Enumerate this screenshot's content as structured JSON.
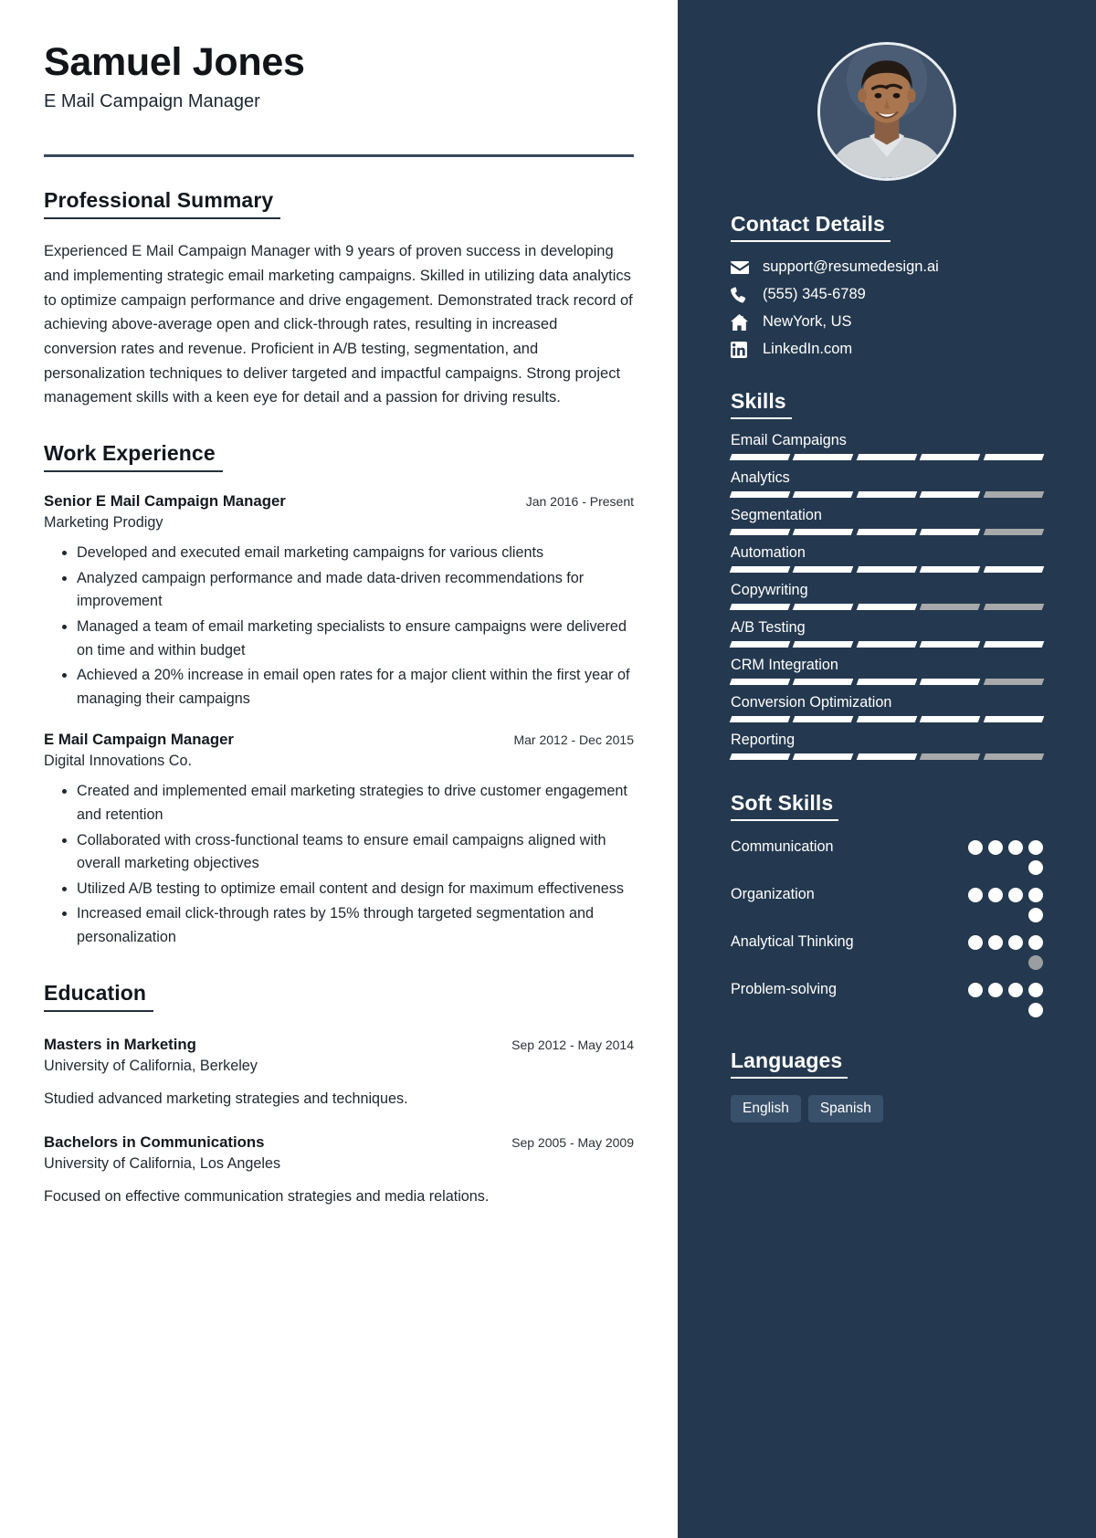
{
  "header": {
    "name": "Samuel Jones",
    "job_title": "E Mail Campaign Manager"
  },
  "theme": {
    "sidebar_bg": "#24394f",
    "rule_color": "#36495c",
    "segment_on": "#ffffff",
    "segment_off": "#a7a9ab",
    "pill_bg": "#39506a"
  },
  "professional_summary": {
    "title": "Professional Summary",
    "text": "Experienced E Mail Campaign Manager with 9 years of proven success in developing and implementing strategic email marketing campaigns. Skilled in utilizing data analytics to optimize campaign performance and drive engagement. Demonstrated track record of achieving above-average open and click-through rates, resulting in increased conversion rates and revenue. Proficient in A/B testing, segmentation, and personalization techniques to deliver targeted and impactful campaigns. Strong project management skills with a keen eye for detail and a passion for driving results."
  },
  "work_experience": {
    "title": "Work Experience",
    "entries": [
      {
        "role": "Senior E Mail Campaign Manager",
        "date": "Jan 2016 - Present",
        "organization": "Marketing Prodigy",
        "bullets": [
          "Developed and executed email marketing campaigns for various clients",
          "Analyzed campaign performance and made data-driven recommendations for improvement",
          "Managed a team of email marketing specialists to ensure campaigns were delivered on time and within budget",
          "Achieved a 20% increase in email open rates for a major client within the first year of managing their campaigns"
        ]
      },
      {
        "role": "E Mail Campaign Manager",
        "date": "Mar 2012 - Dec 2015",
        "organization": "Digital Innovations Co.",
        "bullets": [
          "Created and implemented email marketing strategies to drive customer engagement and retention",
          "Collaborated with cross-functional teams to ensure email campaigns aligned with overall marketing objectives",
          "Utilized A/B testing to optimize email content and design for maximum effectiveness",
          "Increased email click-through rates by 15% through targeted segmentation and personalization"
        ]
      }
    ]
  },
  "education": {
    "title": "Education",
    "entries": [
      {
        "degree": "Masters in Marketing",
        "date": "Sep 2012 - May 2014",
        "institution": "University of California, Berkeley",
        "description": "Studied advanced marketing strategies and techniques."
      },
      {
        "degree": "Bachelors in Communications",
        "date": "Sep 2005 - May 2009",
        "institution": "University of California, Los Angeles",
        "description": "Focused on effective communication strategies and media relations."
      }
    ]
  },
  "contact": {
    "title": "Contact Details",
    "items": [
      {
        "icon": "envelope-icon",
        "value": "support@resumedesign.ai"
      },
      {
        "icon": "phone-icon",
        "value": "(555) 345-6789"
      },
      {
        "icon": "home-icon",
        "value": "NewYork, US"
      },
      {
        "icon": "linkedin-icon",
        "value": "LinkedIn.com"
      }
    ]
  },
  "skills": {
    "title": "Skills",
    "max_level": 5,
    "items": [
      {
        "name": "Email Campaigns",
        "level": 5
      },
      {
        "name": "Analytics",
        "level": 4
      },
      {
        "name": "Segmentation",
        "level": 4
      },
      {
        "name": "Automation",
        "level": 5
      },
      {
        "name": "Copywriting",
        "level": 3
      },
      {
        "name": "A/B Testing",
        "level": 5
      },
      {
        "name": "CRM Integration",
        "level": 4
      },
      {
        "name": "Conversion Optimization",
        "level": 5
      },
      {
        "name": "Reporting",
        "level": 3
      }
    ]
  },
  "soft_skills": {
    "title": "Soft Skills",
    "max_level": 5,
    "items": [
      {
        "name": "Communication",
        "level": 5
      },
      {
        "name": "Organization",
        "level": 5
      },
      {
        "name": "Analytical Thinking",
        "level": 4
      },
      {
        "name": "Problem-solving",
        "level": 5
      }
    ]
  },
  "languages": {
    "title": "Languages",
    "items": [
      "English",
      "Spanish"
    ]
  }
}
